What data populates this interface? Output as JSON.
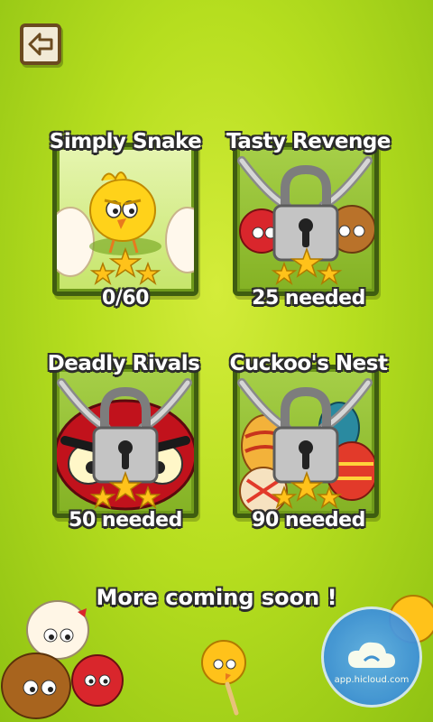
{
  "header": {
    "back_icon": "back-arrow-icon"
  },
  "packs": [
    {
      "title": "Simply Snake",
      "status": "0/60",
      "locked": false
    },
    {
      "title": "Tasty Revenge",
      "status": "25 needed",
      "locked": true
    },
    {
      "title": "Deadly Rivals",
      "status": "50 needed",
      "locked": true
    },
    {
      "title": "Cuckoo's Nest",
      "status": "90 needed",
      "locked": true
    }
  ],
  "footer": {
    "message": "More coming soon !"
  },
  "watermark": {
    "text": "app.hicloud.com"
  },
  "colors": {
    "background": "#b6de1f",
    "card_border": "#3f5d10",
    "star": "#ffc21a",
    "lock": "#b9b9b9"
  }
}
